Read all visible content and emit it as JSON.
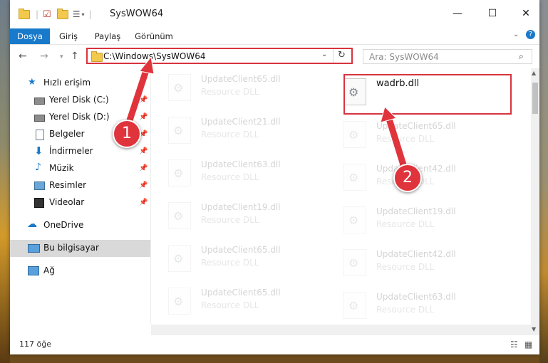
{
  "window": {
    "title": "SysWOW64"
  },
  "ribbon": {
    "tabs": [
      "Dosya",
      "Giriş",
      "Paylaş",
      "Görünüm"
    ]
  },
  "address": {
    "path": "C:\\Windows\\SysWOW64"
  },
  "search": {
    "placeholder": "Ara: SysWOW64"
  },
  "sidebar": {
    "items": [
      {
        "label": "Hızlı erişim",
        "icon": "star-icon"
      },
      {
        "label": "Yerel Disk (C:)",
        "icon": "drive-icon"
      },
      {
        "label": "Yerel Disk (D:)",
        "icon": "drive-icon"
      },
      {
        "label": "Belgeler",
        "icon": "documents-icon"
      },
      {
        "label": "İndirmeler",
        "icon": "download-icon"
      },
      {
        "label": "Müzik",
        "icon": "music-icon"
      },
      {
        "label": "Resimler",
        "icon": "pictures-icon"
      },
      {
        "label": "Videolar",
        "icon": "video-icon"
      },
      {
        "label": "OneDrive",
        "icon": "cloud-icon"
      },
      {
        "label": "Bu bilgisayar",
        "icon": "computer-icon"
      },
      {
        "label": "Ağ",
        "icon": "network-icon"
      }
    ]
  },
  "files": {
    "left": [
      {
        "name": "UpdateClient65.dll",
        "type": "Resource DLL"
      },
      {
        "name": "UpdateClient21.dll",
        "type": "Resource DLL"
      },
      {
        "name": "UpdateClient63.dll",
        "type": "Resource DLL"
      },
      {
        "name": "UpdateClient19.dll",
        "type": "Resource DLL"
      },
      {
        "name": "UpdateClient65.dll",
        "type": "Resource DLL"
      },
      {
        "name": "UpdateClient65.dll",
        "type": "Resource DLL"
      }
    ],
    "right": [
      {
        "name": "wadrb.dll",
        "type": ""
      },
      {
        "name": "UpdateClient65.dll",
        "type": "Resource DLL"
      },
      {
        "name": "UpdateClient42.dll",
        "type": "Resource DLL"
      },
      {
        "name": "UpdateClient19.dll",
        "type": "Resource DLL"
      },
      {
        "name": "UpdateClient42.dll",
        "type": "Resource DLL"
      },
      {
        "name": "UpdateClient63.dll",
        "type": "Resource DLL"
      }
    ]
  },
  "status": {
    "count": "117 öğe"
  },
  "annotations": {
    "badge1": "1",
    "badge2": "2"
  },
  "colors": {
    "accent": "#1979ca",
    "highlight": "#d8333f"
  }
}
